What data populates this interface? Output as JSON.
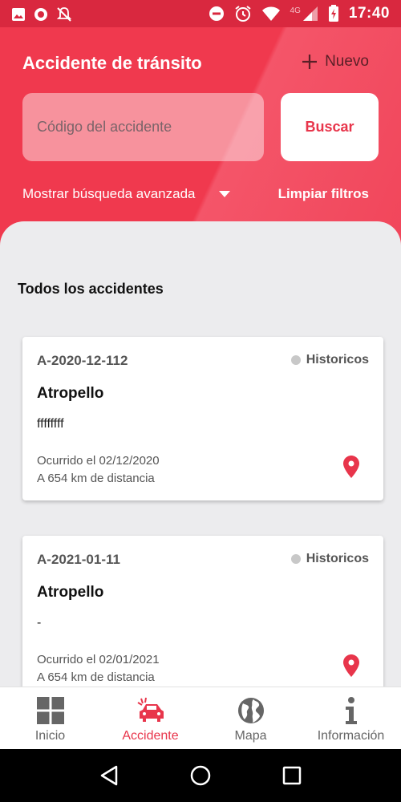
{
  "status_bar": {
    "time": "17:40",
    "network": "4G"
  },
  "header": {
    "title": "Accidente de tránsito",
    "new_label": "Nuevo",
    "search_placeholder": "Código del accidente",
    "search_label": "Buscar",
    "advanced_label": "Mostrar búsqueda avanzada",
    "clear_label": "Limpiar filtros"
  },
  "section_title": "Todos los accidentes",
  "accidents": [
    {
      "code": "A-2020-12-112",
      "status": "Historicos",
      "type": "Atropello",
      "description": "ffffffff",
      "date": "Ocurrido el 02/12/2020",
      "distance": "A 654 km de distancia"
    },
    {
      "code": "A-2021-01-11",
      "status": "Historicos",
      "type": "Atropello",
      "description": "-",
      "date": "Ocurrido el 02/01/2021",
      "distance": "A 654 km de distancia"
    }
  ],
  "bottom_nav": [
    {
      "label": "Inicio",
      "icon": "grid-icon",
      "active": false
    },
    {
      "label": "Accidente",
      "icon": "car-crash-icon",
      "active": true
    },
    {
      "label": "Mapa",
      "icon": "globe-icon",
      "active": false
    },
    {
      "label": "Información",
      "icon": "info-icon",
      "active": false
    }
  ],
  "colors": {
    "accent": "#e8354b",
    "header": "#f0394e",
    "status_bar": "#d9283f"
  }
}
